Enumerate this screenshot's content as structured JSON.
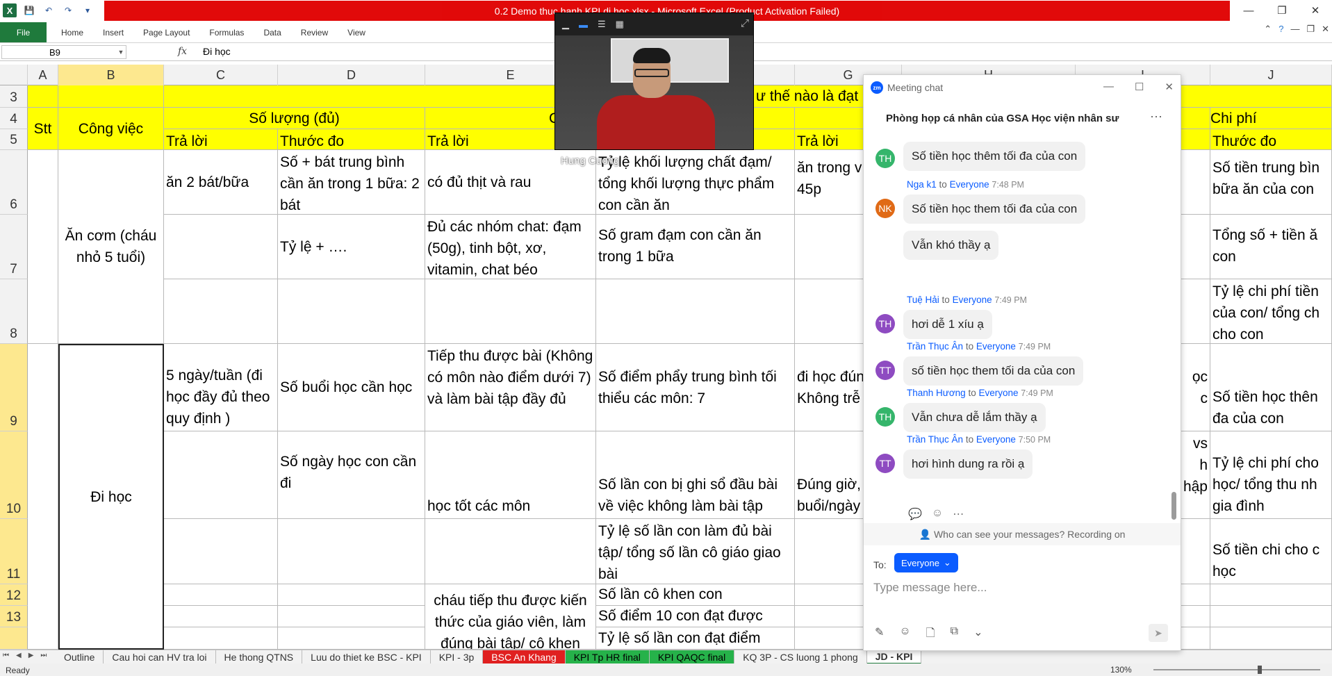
{
  "excel": {
    "window_title": "0.2 Demo thuc hanh KPI di hoc.xlsx - Microsoft Excel (Product Activation Failed)",
    "file_tab": "File",
    "tabs": [
      "Home",
      "Insert",
      "Page Layout",
      "Formulas",
      "Data",
      "Review",
      "View"
    ],
    "name_box": "B9",
    "fx": "fx",
    "formula": "Đi học",
    "columns": [
      "A",
      "B",
      "C",
      "D",
      "E",
      "F",
      "G",
      "H",
      "I",
      "J"
    ],
    "rows": [
      "3",
      "4",
      "5",
      "6",
      "7",
      "8",
      "9",
      "10",
      "11",
      "12",
      "13"
    ],
    "headers": {
      "stt": "Stt",
      "cong_viec": "Công việc",
      "so_luong": "Số lượng (đủ)",
      "chat_luong_partial": "C",
      "nhu_the_nao": "ư thế nào là đạt",
      "chi_phi": "Chi phí",
      "tra_loi": "Trả lời",
      "thuoc_do": "Thước đo"
    },
    "cells": {
      "B6": "Ăn cơm (cháu nhỏ 5 tuổi)",
      "C6": "ăn 2 bát/bữa",
      "D6": "Số + bát trung bình cần ăn trong 1 bữa: 2 bát",
      "E6": "có đủ thịt và rau",
      "F6": "Tỷ lệ khối lượng chất đạm/ tổng khối lượng thực phẩm con cần ăn",
      "G6": "ăn trong v 30p-45p",
      "J6": "Số tiền trung bìn bữa ăn của con",
      "D7": "Tỷ lệ + ….",
      "E7": "Đủ các nhóm chat: đạm (50g), tinh bột, xơ, vitamin, chat béo",
      "F7": "Số gram đạm con cần ăn trong 1 bữa",
      "J7": "Tổng số + tiền ă con",
      "J8": "Tỷ lệ chi phí tiền của con/ tổng ch cho con",
      "B9": "Đi học",
      "C9": "5 ngày/tuần (đi học đầy đủ theo quy định )",
      "D9": "Số buổi học cần học",
      "E9": "Tiếp thu được bài (Không có môn nào điểm dưới 7) và làm bài tập đầy đủ",
      "F9": "Số điểm phẩy trung bình tối thiểu các môn: 7",
      "G9": "đi học đún giờ, Không trễ",
      "I9": "ọc\nc",
      "J9": "Số tiền học thên đa của con",
      "D10": "Số ngày học con cần đi",
      "E10": "học tốt các môn",
      "F10": "Số lần con bị ghi sổ đầu bài về việc không làm bài tập",
      "G10": "Đúng giờ, buổi/ngày",
      "I10": "vs\nh\nhập",
      "J10": "Tỷ lệ chi phí cho học/ tổng thu nh gia đình",
      "F11": "Tỷ lệ số lần con làm đủ bài tập/ tổng số lần cô giáo giao bài",
      "J11": "Số tiền chi cho c học",
      "E12": "cháu tiếp thu được kiến thức của giáo viên, làm đúng bài tập/ cô khen",
      "F12": "Số lần cô khen con",
      "F13": "Số điểm 10 con đạt được",
      "F14": "Tỷ lệ số lần con đạt điểm"
    },
    "sheet_tabs": [
      "Outline",
      "Cau hoi can HV tra loi",
      "He thong QTNS",
      "Luu do thiet ke BSC - KPI",
      "KPI - 3p",
      "BSC An Khang",
      "KPI Tp HR final",
      "KPI QAQC final",
      "KQ 3P - CS luong 1 phong",
      "JD - KPI"
    ],
    "status": "Ready",
    "zoom": "130%"
  },
  "video": {
    "participant": "Hung Cuong"
  },
  "chat": {
    "title": "Meeting chat",
    "logo": "zm",
    "room": "Phòng họp cá nhân của GSA Học viện nhân sư",
    "messages": [
      {
        "initials": "TH",
        "color": "#35b56b",
        "sender": "",
        "to": "",
        "time": "",
        "text": "Số tiền học thêm tối đa của con"
      },
      {
        "initials": "NK",
        "color": "#e06a16",
        "sender": "Nga k1",
        "to": "to",
        "target": "Everyone",
        "time": "7:48 PM",
        "text": "Số tiền học them tối đa của con"
      },
      {
        "initials": "",
        "sender": "",
        "to": "",
        "time": "",
        "text": "Vẫn khó thầy ạ"
      },
      {
        "initials": "TH",
        "color": "#8e4bc1",
        "sender": "Tuệ Hải",
        "to": "to",
        "target": "Everyone",
        "time": "7:49 PM",
        "text": "hơi dễ 1 xíu ạ"
      },
      {
        "initials": "TT",
        "color": "#8e4bc1",
        "sender": "Trần Thục Ân",
        "to": "to",
        "target": "Everyone",
        "time": "7:49 PM",
        "text": "số tiền học them tối da của con"
      },
      {
        "initials": "TH",
        "color": "#35b56b",
        "sender": "Thanh Hương",
        "to": "to",
        "target": "Everyone",
        "time": "7:49 PM",
        "text": "Vẫn chưa dễ lắm thầy ạ"
      },
      {
        "initials": "TT",
        "color": "#8e4bc1",
        "sender": "Trần Thục Ân",
        "to": "to",
        "target": "Everyone",
        "time": "7:50 PM",
        "text": "hơi hình dung ra rồi ạ"
      }
    ],
    "who_can_see": "Who can see your messages? Recording on",
    "to_label": "To:",
    "to_value": "Everyone",
    "placeholder": "Type message here..."
  }
}
